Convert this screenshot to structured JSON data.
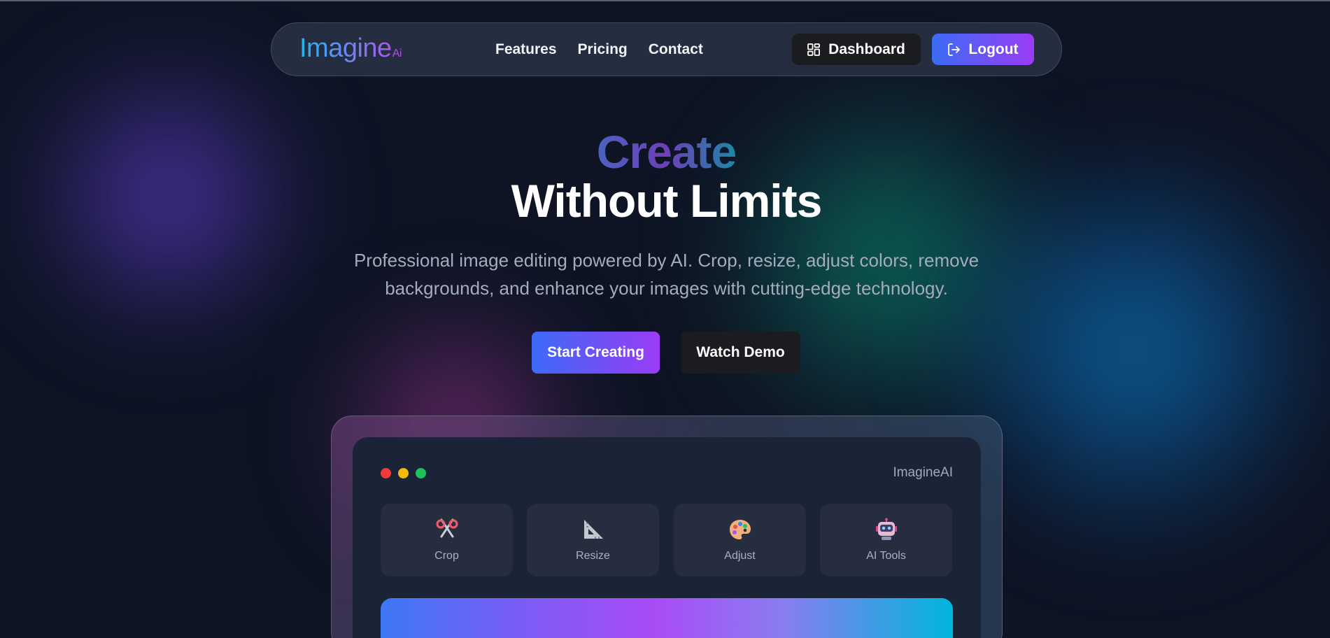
{
  "brand": {
    "name": "Imagine",
    "suffix": "Ai"
  },
  "nav": {
    "links": [
      "Features",
      "Pricing",
      "Contact"
    ],
    "dashboard_label": "Dashboard",
    "logout_label": "Logout"
  },
  "hero": {
    "title_accent": "Create",
    "title_main": "Without Limits",
    "subtitle": "Professional image editing powered by AI. Crop, resize, adjust colors, remove backgrounds, and enhance your images with cutting-edge technology.",
    "primary_cta": "Start Creating",
    "secondary_cta": "Watch Demo"
  },
  "preview": {
    "app_name": "ImagineAI",
    "tools": [
      {
        "label": "Crop",
        "icon": "scissors-icon"
      },
      {
        "label": "Resize",
        "icon": "triangle-ruler-icon"
      },
      {
        "label": "Adjust",
        "icon": "palette-icon"
      },
      {
        "label": "AI Tools",
        "icon": "robot-icon"
      }
    ]
  },
  "colors": {
    "background": "#0e1424",
    "accent_start": "#3b6cf6",
    "accent_end": "#9a3cf6",
    "dark_button": "#1b1c1f"
  }
}
